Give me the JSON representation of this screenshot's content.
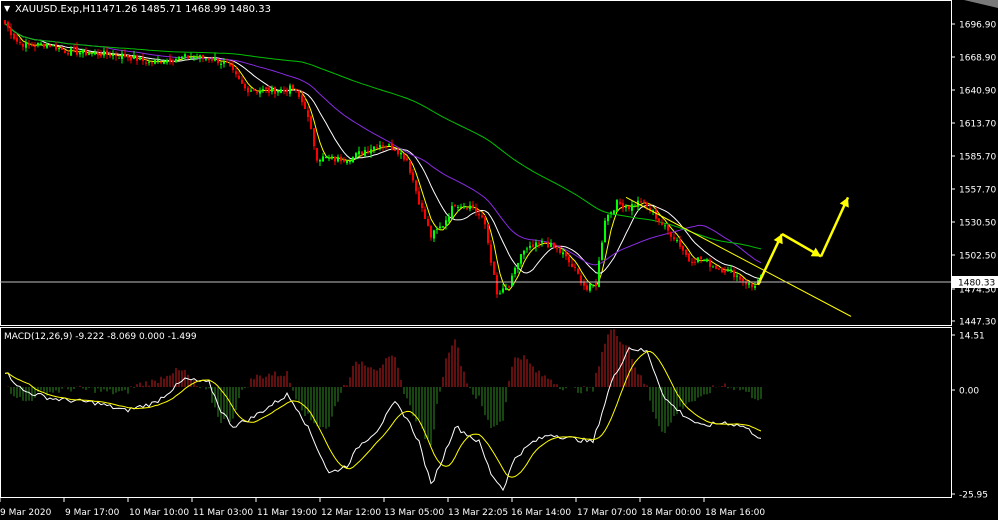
{
  "header": {
    "arrow_glyph": "▼",
    "symbol": "XAUUSD.Exp,H1",
    "ohlc": "1471.26 1485.71 1468.99 1480.33"
  },
  "price_axis": {
    "ticks": [
      "1696.90",
      "1668.90",
      "1640.90",
      "1613.70",
      "1585.70",
      "1557.70",
      "1530.50",
      "1502.50",
      "1474.50",
      "1447.30"
    ],
    "current_price": "1480.33"
  },
  "macd_panel": {
    "label": "MACD(12,26,9) -9.222 -8.069 0.000 -1.499",
    "ticks": [
      "14.51",
      "0.00",
      "-25.95"
    ]
  },
  "time_axis": {
    "labels": [
      "9 Mar 2020",
      "9 Mar 17:00",
      "10 Mar 10:00",
      "11 Mar 03:00",
      "11 Mar 19:00",
      "12 Mar 12:00",
      "13 Mar 05:00",
      "13 Mar 22:05",
      "16 Mar 14:00",
      "17 Mar 07:00",
      "18 Mar 00:00",
      "18 Mar 16:00"
    ]
  },
  "colors": {
    "background": "#000000",
    "bull": "#00ff00",
    "bear": "#ff0000",
    "ma_fast": "#ffff00",
    "ma_mid": "#ffffff",
    "ma_slow": "#8a2be2",
    "ma_long": "#00c000",
    "hist_pos": "#c81e1e",
    "hist_neg": "#2e8b22",
    "annotation": "#ffff00",
    "grid_text": "#ffffff"
  },
  "chart_data": {
    "type": "candlestick",
    "symbol": "XAUUSD.Exp",
    "timeframe": "H1",
    "ylim": [
      1440,
      1715
    ],
    "close_anchors": [
      [
        0,
        1695
      ],
      [
        4,
        1680
      ],
      [
        8,
        1676
      ],
      [
        14,
        1678
      ],
      [
        20,
        1672
      ],
      [
        28,
        1670
      ],
      [
        40,
        1668
      ],
      [
        48,
        1662
      ],
      [
        55,
        1665
      ],
      [
        62,
        1667
      ],
      [
        70,
        1665
      ],
      [
        74,
        1660
      ],
      [
        80,
        1640
      ],
      [
        88,
        1638
      ],
      [
        96,
        1640
      ],
      [
        100,
        1625
      ],
      [
        104,
        1582
      ],
      [
        110,
        1580
      ],
      [
        116,
        1582
      ],
      [
        120,
        1588
      ],
      [
        125,
        1593
      ],
      [
        130,
        1590
      ],
      [
        134,
        1580
      ],
      [
        138,
        1545
      ],
      [
        142,
        1515
      ],
      [
        146,
        1525
      ],
      [
        150,
        1543
      ],
      [
        156,
        1540
      ],
      [
        160,
        1525
      ],
      [
        164,
        1465
      ],
      [
        168,
        1472
      ],
      [
        172,
        1500
      ],
      [
        176,
        1506
      ],
      [
        180,
        1510
      ],
      [
        186,
        1500
      ],
      [
        190,
        1486
      ],
      [
        194,
        1470
      ],
      [
        197,
        1475
      ],
      [
        200,
        1530
      ],
      [
        204,
        1543
      ],
      [
        208,
        1540
      ],
      [
        212,
        1545
      ],
      [
        216,
        1535
      ],
      [
        220,
        1522
      ],
      [
        224,
        1512
      ],
      [
        228,
        1495
      ],
      [
        232,
        1496
      ],
      [
        236,
        1490
      ],
      [
        242,
        1485
      ],
      [
        246,
        1478
      ],
      [
        249,
        1472
      ],
      [
        252,
        1480
      ]
    ],
    "macd_anchors": [
      [
        0,
        4
      ],
      [
        6,
        -1
      ],
      [
        16,
        -3
      ],
      [
        30,
        -4
      ],
      [
        40,
        -6
      ],
      [
        50,
        -4
      ],
      [
        60,
        2
      ],
      [
        68,
        1
      ],
      [
        72,
        -6
      ],
      [
        76,
        -10
      ],
      [
        82,
        -8
      ],
      [
        88,
        -5
      ],
      [
        94,
        -2
      ],
      [
        98,
        -6
      ],
      [
        102,
        -12
      ],
      [
        108,
        -22
      ],
      [
        114,
        -20
      ],
      [
        118,
        -15
      ],
      [
        124,
        -11
      ],
      [
        130,
        -4
      ],
      [
        134,
        -8
      ],
      [
        138,
        -14
      ],
      [
        142,
        -25
      ],
      [
        146,
        -18
      ],
      [
        150,
        -10
      ],
      [
        154,
        -12
      ],
      [
        158,
        -14
      ],
      [
        162,
        -22
      ],
      [
        166,
        -26
      ],
      [
        170,
        -18
      ],
      [
        176,
        -14
      ],
      [
        182,
        -12
      ],
      [
        188,
        -13
      ],
      [
        196,
        -14
      ],
      [
        202,
        1
      ],
      [
        208,
        10
      ],
      [
        214,
        9
      ],
      [
        220,
        -3
      ],
      [
        226,
        -7
      ],
      [
        232,
        -10
      ],
      [
        240,
        -9
      ],
      [
        246,
        -10
      ],
      [
        252,
        -13
      ]
    ],
    "macd_params": [
      12,
      26,
      9
    ],
    "macd_values": [
      -9.222,
      -8.069,
      0.0,
      -1.499
    ],
    "macd_ylim": [
      -28,
      14.51
    ],
    "moving_averages": [
      {
        "period": 5,
        "color": "yellow"
      },
      {
        "period": 13,
        "color": "white"
      },
      {
        "period": 34,
        "color": "purple"
      },
      {
        "period": 100,
        "color": "green"
      }
    ],
    "trendline": {
      "from": [
        1548,
        207
      ],
      "to": [
        1447.3,
        282
      ]
    },
    "forecast_arrows": [
      [
        1474,
        1517
      ],
      [
        1517,
        1498
      ],
      [
        1498,
        1548
      ]
    ]
  }
}
